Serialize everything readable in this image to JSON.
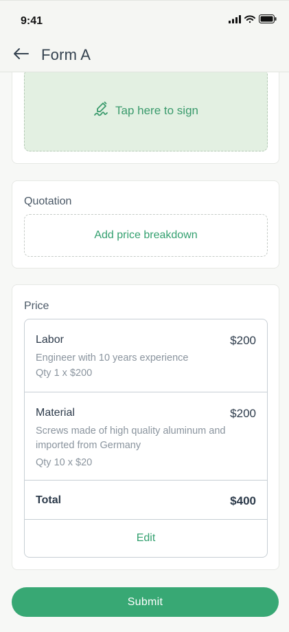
{
  "status_bar": {
    "time": "9:41"
  },
  "header": {
    "title": "Form A"
  },
  "signature": {
    "prompt": "Tap here to sign"
  },
  "quotation": {
    "label": "Quotation",
    "add_label": "Add price breakdown"
  },
  "price": {
    "label": "Price",
    "items": [
      {
        "name": "Labor",
        "amount": "$200",
        "description": "Engineer with 10 years experience",
        "qty": "Qty 1 x $200"
      },
      {
        "name": "Material",
        "amount": "$200",
        "description": "Screws made of high quality aluminum and imported from Germany",
        "qty": "Qty 10 x $20"
      }
    ],
    "total_label": "Total",
    "total_value": "$400",
    "edit_label": "Edit"
  },
  "submit_label": "Submit",
  "colors": {
    "accent": "#38a874",
    "sign_bg": "#e3f0e2",
    "text": "#2c3a4a",
    "muted": "#8a949e"
  }
}
